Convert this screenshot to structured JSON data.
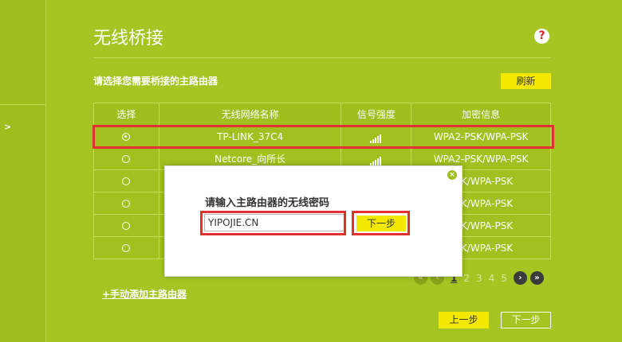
{
  "page": {
    "title": "无线桥接",
    "help_icon": "?",
    "subtitle": "请选择您需要桥接的主路由器",
    "refresh_label": "刷新",
    "manual_add_label": "+手动添加主路由器",
    "prev_label": "上一步",
    "next_label": "下一步"
  },
  "sidebar": {
    "arrow": ">"
  },
  "table": {
    "headers": [
      "选择",
      "无线网络名称",
      "信号强度",
      "加密信息"
    ],
    "rows": [
      {
        "selected": true,
        "ssid": "TP-LINK_37C4",
        "security": "WPA2-PSK/WPA-PSK"
      },
      {
        "selected": false,
        "ssid": "Netcore_向所长",
        "security": "WPA2-PSK/WPA-PSK"
      },
      {
        "selected": false,
        "ssid": "",
        "security": "PSK/WPA-PSK"
      },
      {
        "selected": false,
        "ssid": "",
        "security": "PSK/WPA-PSK"
      },
      {
        "selected": false,
        "ssid": "",
        "security": "PSK/WPA-PSK"
      },
      {
        "selected": false,
        "ssid": "",
        "security": "PSK/WPA-PSK"
      }
    ]
  },
  "pager": {
    "pages": [
      "1",
      "2",
      "3",
      "4",
      "5"
    ],
    "current": "1"
  },
  "dialog": {
    "prompt": "请输入主路由器的无线密码",
    "password_value": "YIPOJIE.CN",
    "next_label": "下一步",
    "close_icon": "×"
  },
  "colors": {
    "background": "#a6c523",
    "accent_button": "#f3e800",
    "highlight": "#e2312f"
  }
}
